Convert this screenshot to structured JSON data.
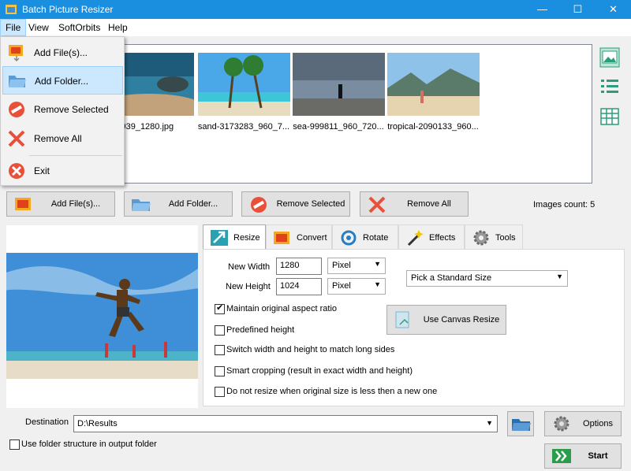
{
  "window": {
    "title": "Batch Picture Resizer",
    "controls": {
      "minimize": "—",
      "maximize": "☐",
      "close": "✕"
    }
  },
  "menubar": {
    "items": [
      "File",
      "View",
      "SoftOrbits",
      "Help"
    ],
    "active": "File"
  },
  "file_menu": {
    "items": [
      {
        "label": "Add File(s)...",
        "icon": "image-add-icon"
      },
      {
        "label": "Add Folder...",
        "icon": "folder-icon",
        "highlighted": true
      },
      {
        "label": "Remove Selected",
        "icon": "remove-circle-icon"
      },
      {
        "label": "Remove All",
        "icon": "red-x-icon"
      },
      {
        "label": "Exit",
        "icon": "exit-icon"
      }
    ]
  },
  "images": {
    "items": [
      {
        "label": "1614939_1280.jpg"
      },
      {
        "label": "sand-3173283_960_7..."
      },
      {
        "label": "sea-999811_960_720..."
      },
      {
        "label": "tropical-2090133_960..."
      }
    ],
    "count_label": "Images count: 5"
  },
  "view_icons": [
    "thumbnails-view-icon",
    "list-view-icon",
    "table-view-icon"
  ],
  "toolbar": {
    "add_files": "Add File(s)...",
    "add_folder": "Add Folder...",
    "remove_selected": "Remove Selected",
    "remove_all": "Remove All"
  },
  "tabs": [
    {
      "label": "Resize",
      "icon": "resize-arrow-icon",
      "selected": true
    },
    {
      "label": "Convert",
      "icon": "convert-image-icon"
    },
    {
      "label": "Rotate",
      "icon": "rotate-icon"
    },
    {
      "label": "Effects",
      "icon": "magic-wand-icon"
    },
    {
      "label": "Tools",
      "icon": "gear-icon"
    }
  ],
  "resize": {
    "new_width_label": "New Width",
    "new_width_value": "1280",
    "new_height_label": "New Height",
    "new_height_value": "1024",
    "unit_width": "Pixel",
    "unit_height": "Pixel",
    "standard_size": "Pick a Standard Size",
    "canvas_resize": "Use Canvas Resize",
    "options": [
      {
        "label": "Maintain original aspect ratio",
        "checked": true
      },
      {
        "label": "Predefined height",
        "checked": false
      },
      {
        "label": "Switch width and height to match long sides",
        "checked": false
      },
      {
        "label": "Smart cropping (result in exact width and height)",
        "checked": false
      },
      {
        "label": "Do not resize when original size is less then a new one",
        "checked": false
      }
    ]
  },
  "output": {
    "destination_label": "Destination",
    "destination_value": "D:\\Results",
    "folder_structure_label": "Use folder structure in output folder",
    "folder_structure_checked": false,
    "options_label": "Options",
    "start_label": "Start"
  }
}
